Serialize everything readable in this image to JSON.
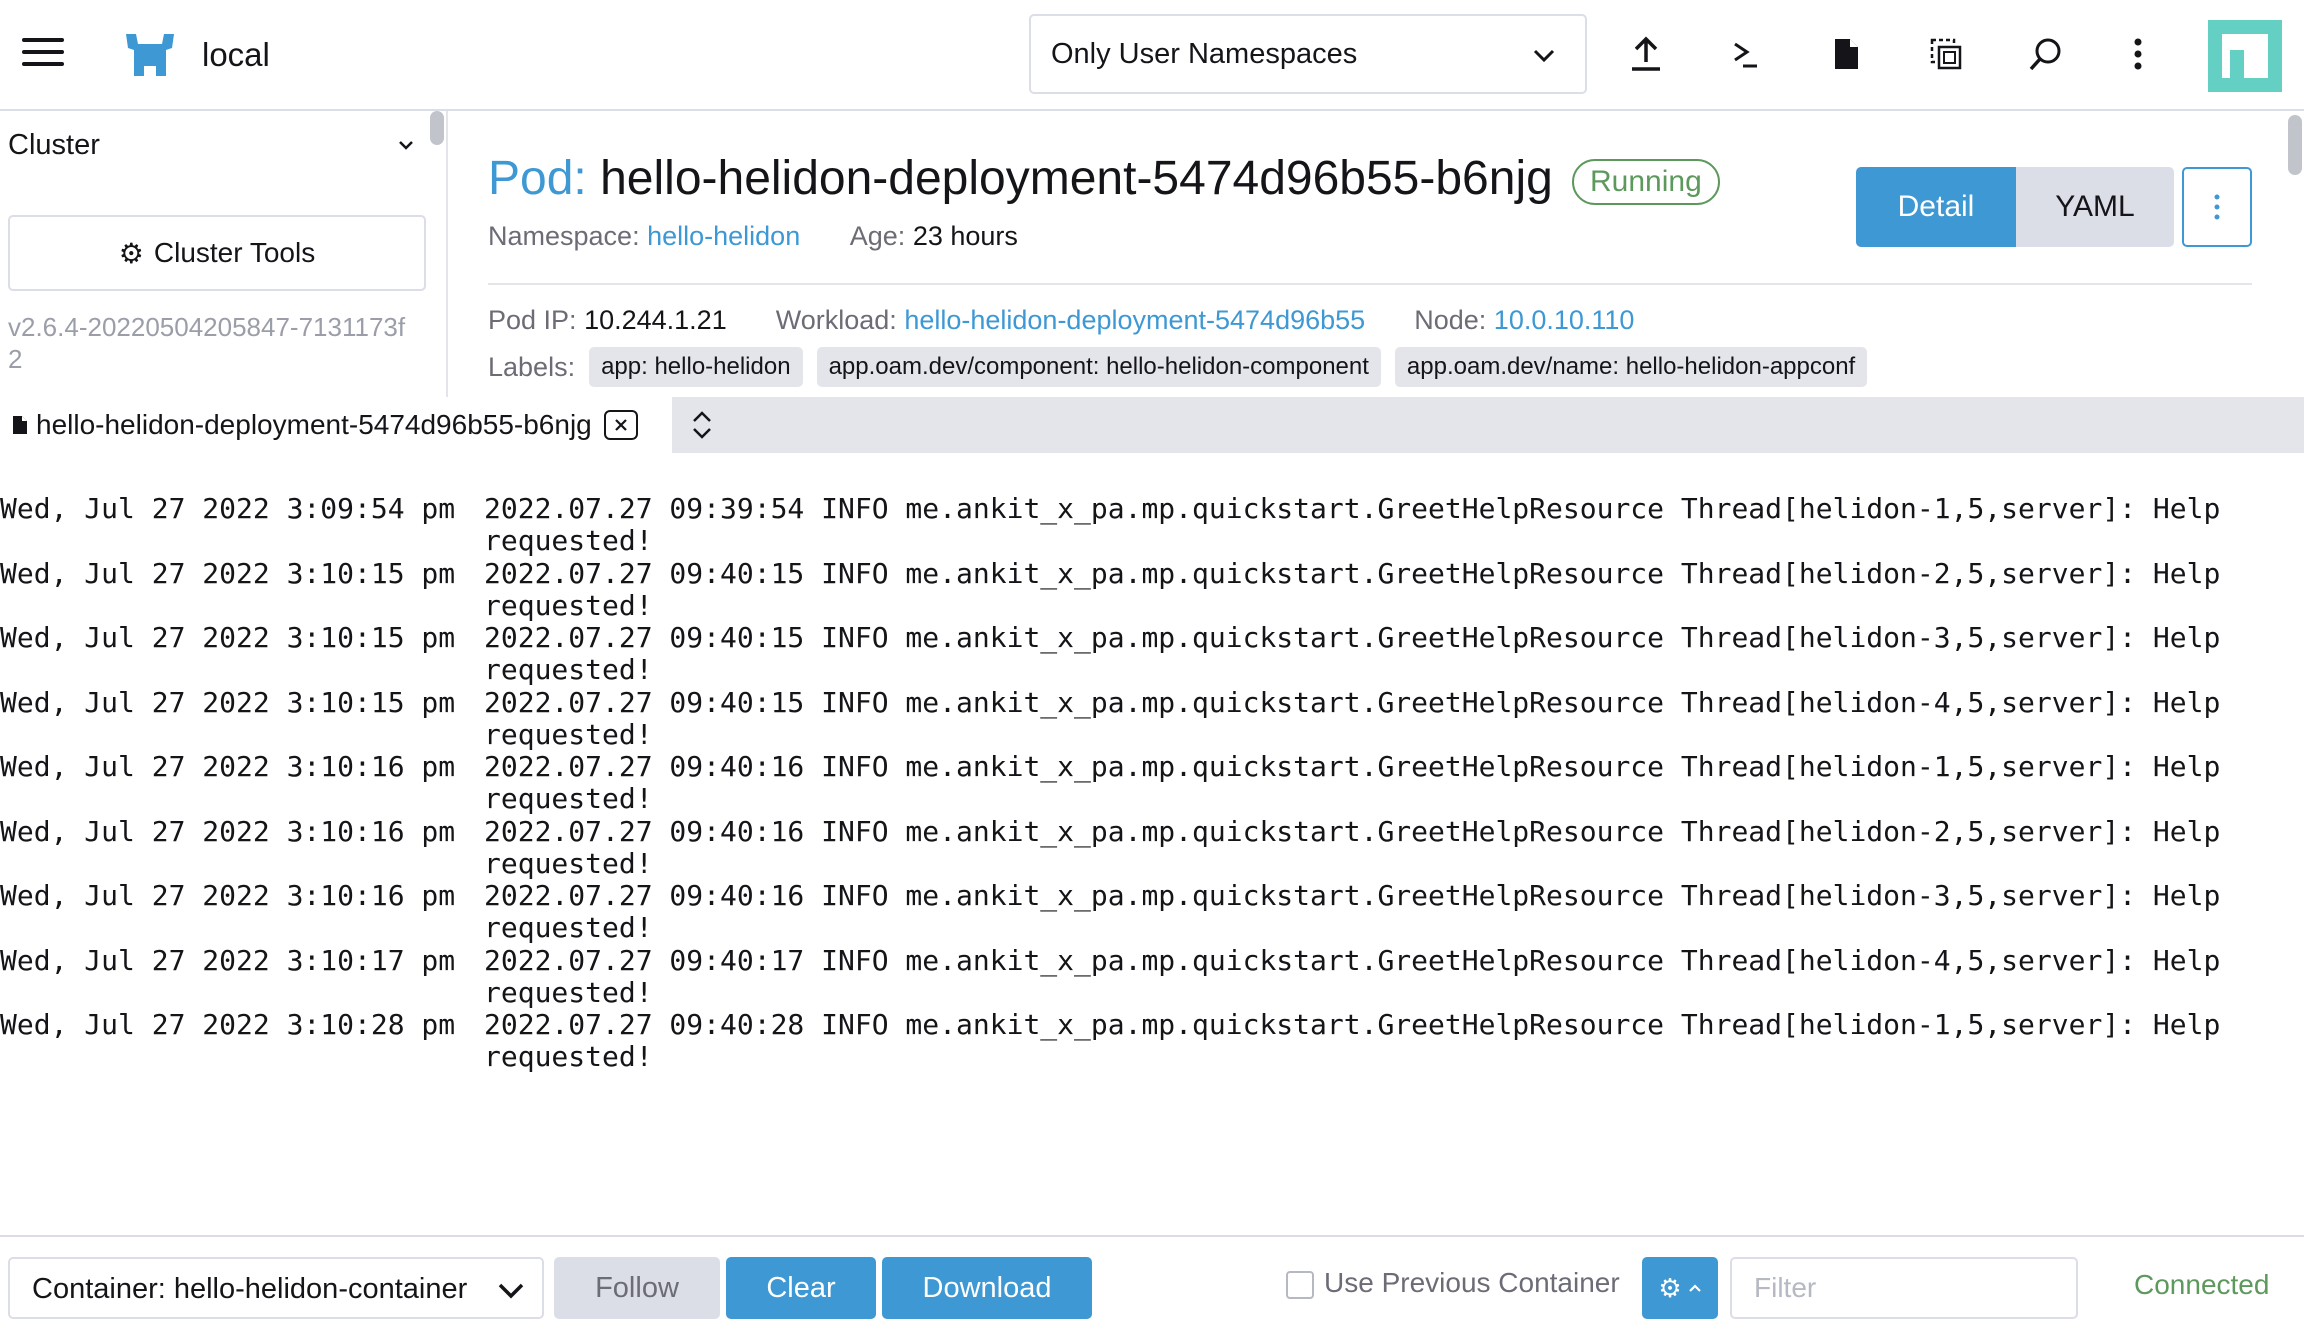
{
  "header": {
    "cluster_name": "local",
    "namespace_filter": "Only User Namespaces"
  },
  "sidebar": {
    "cluster_label": "Cluster",
    "cluster_tools_label": "Cluster Tools",
    "version": "v2.6.4-20220504205847-7131173f2"
  },
  "pod": {
    "prefix": "Pod:",
    "name": "hello-helidon-deployment-5474d96b55-b6njg",
    "status": "Running",
    "namespace_key": "Namespace:",
    "namespace": "hello-helidon",
    "age_key": "Age:",
    "age": "23 hours",
    "pod_ip_key": "Pod IP:",
    "pod_ip": "10.244.1.21",
    "workload_key": "Workload:",
    "workload": "hello-helidon-deployment-5474d96b55",
    "node_key": "Node:",
    "node": "10.0.10.110",
    "labels_key": "Labels:",
    "labels": [
      "app: hello-helidon",
      "app.oam.dev/component: hello-helidon-component",
      "app.oam.dev/name: hello-helidon-appconf"
    ]
  },
  "view_tabs": {
    "detail": "Detail",
    "yaml": "YAML"
  },
  "log_tab": {
    "title": "hello-helidon-deployment-5474d96b55-b6njg"
  },
  "logs": [
    {
      "ts": "Wed, Jul 27 2022 3:09:54 pm",
      "msg": "2022.07.27 09:39:54 INFO me.ankit_x_pa.mp.quickstart.GreetHelpResource Thread[helidon-1,5,server]: Help requested!"
    },
    {
      "ts": "Wed, Jul 27 2022 3:10:15 pm",
      "msg": "2022.07.27 09:40:15 INFO me.ankit_x_pa.mp.quickstart.GreetHelpResource Thread[helidon-2,5,server]: Help requested!"
    },
    {
      "ts": "Wed, Jul 27 2022 3:10:15 pm",
      "msg": "2022.07.27 09:40:15 INFO me.ankit_x_pa.mp.quickstart.GreetHelpResource Thread[helidon-3,5,server]: Help requested!"
    },
    {
      "ts": "Wed, Jul 27 2022 3:10:15 pm",
      "msg": "2022.07.27 09:40:15 INFO me.ankit_x_pa.mp.quickstart.GreetHelpResource Thread[helidon-4,5,server]: Help requested!"
    },
    {
      "ts": "Wed, Jul 27 2022 3:10:16 pm",
      "msg": "2022.07.27 09:40:16 INFO me.ankit_x_pa.mp.quickstart.GreetHelpResource Thread[helidon-1,5,server]: Help requested!"
    },
    {
      "ts": "Wed, Jul 27 2022 3:10:16 pm",
      "msg": "2022.07.27 09:40:16 INFO me.ankit_x_pa.mp.quickstart.GreetHelpResource Thread[helidon-2,5,server]: Help requested!"
    },
    {
      "ts": "Wed, Jul 27 2022 3:10:16 pm",
      "msg": "2022.07.27 09:40:16 INFO me.ankit_x_pa.mp.quickstart.GreetHelpResource Thread[helidon-3,5,server]: Help requested!"
    },
    {
      "ts": "Wed, Jul 27 2022 3:10:17 pm",
      "msg": "2022.07.27 09:40:17 INFO me.ankit_x_pa.mp.quickstart.GreetHelpResource Thread[helidon-4,5,server]: Help requested!"
    },
    {
      "ts": "Wed, Jul 27 2022 3:10:28 pm",
      "msg": "2022.07.27 09:40:28 INFO me.ankit_x_pa.mp.quickstart.GreetHelpResource Thread[helidon-1,5,server]: Help requested!"
    }
  ],
  "footer": {
    "container": "Container: hello-helidon-container",
    "follow": "Follow",
    "clear": "Clear",
    "download": "Download",
    "use_previous": "Use Previous Container",
    "filter_placeholder": "Filter",
    "connection_status": "Connected"
  },
  "colors": {
    "accent": "#3d98d3",
    "success": "#5d995d",
    "brand": "#64d0c4"
  }
}
